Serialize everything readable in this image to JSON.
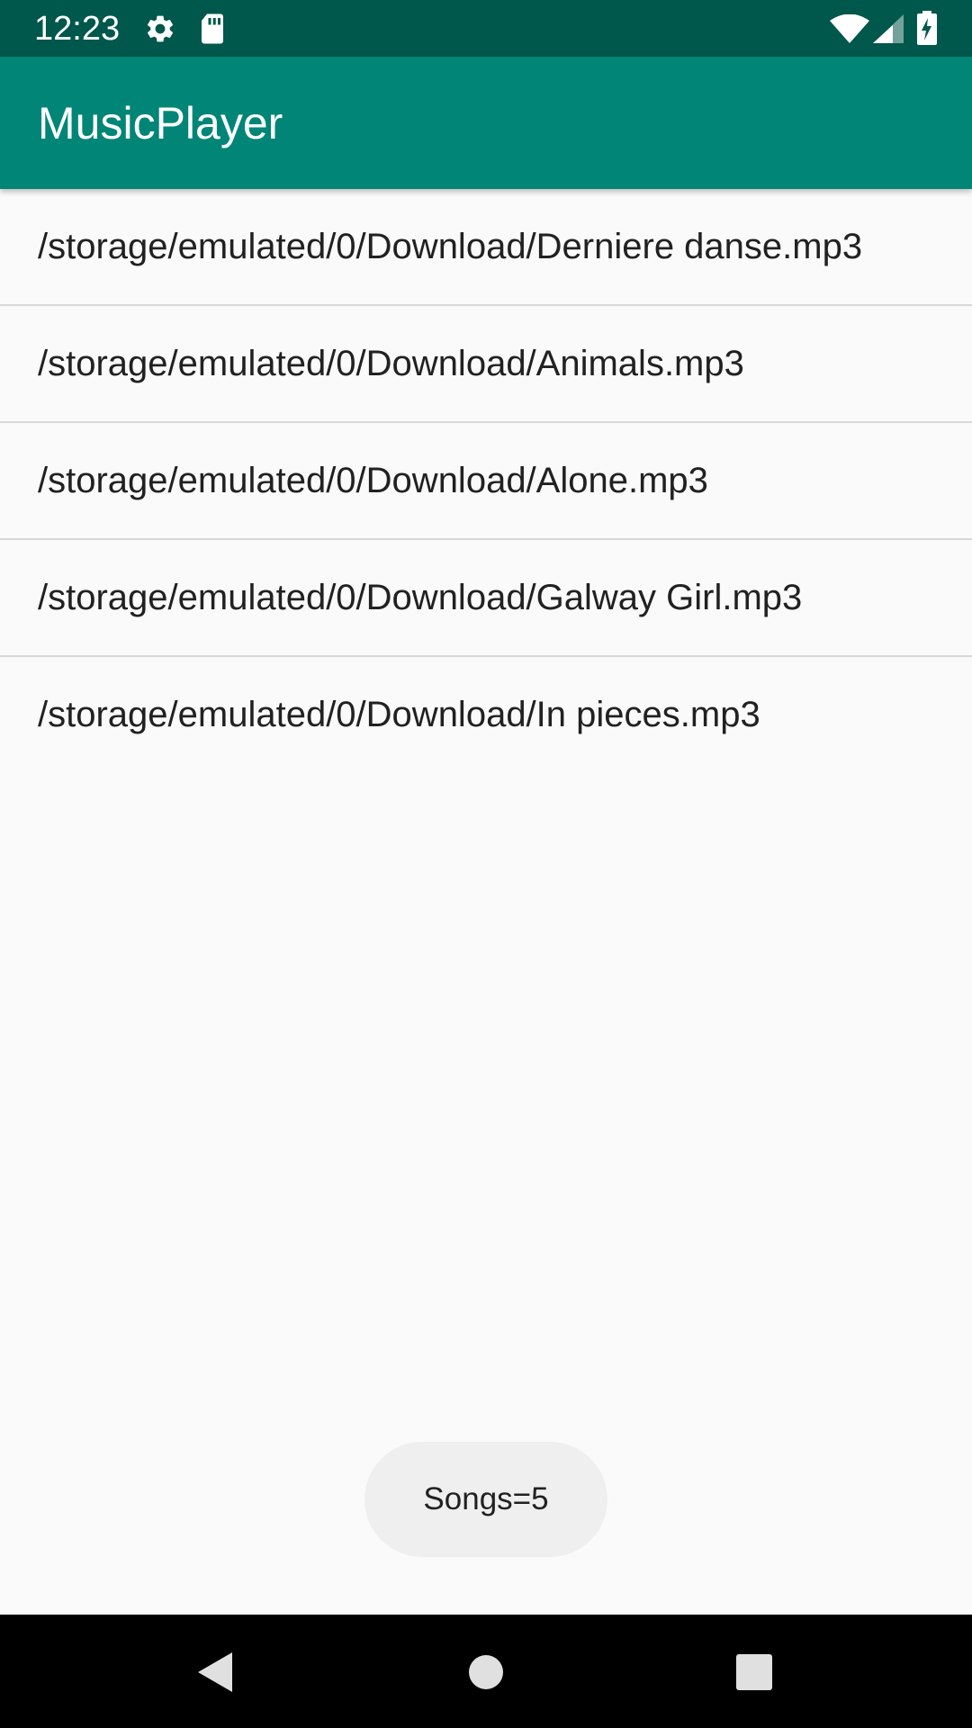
{
  "status_bar": {
    "time": "12:23",
    "icons": [
      "settings-icon",
      "sd-card-icon",
      "wifi-icon",
      "signal-icon",
      "battery-icon"
    ]
  },
  "app_bar": {
    "title": "MusicPlayer",
    "color": "#008577"
  },
  "songs": [
    "/storage/emulated/0/Download/Derniere danse.mp3",
    "/storage/emulated/0/Download/Animals.mp3",
    "/storage/emulated/0/Download/Alone.mp3",
    "/storage/emulated/0/Download/Galway Girl.mp3",
    "/storage/emulated/0/Download/In pieces.mp3"
  ],
  "toast": {
    "text": "Songs=5"
  },
  "nav_bar": {
    "buttons": [
      "back-icon",
      "home-icon",
      "recents-icon"
    ]
  }
}
